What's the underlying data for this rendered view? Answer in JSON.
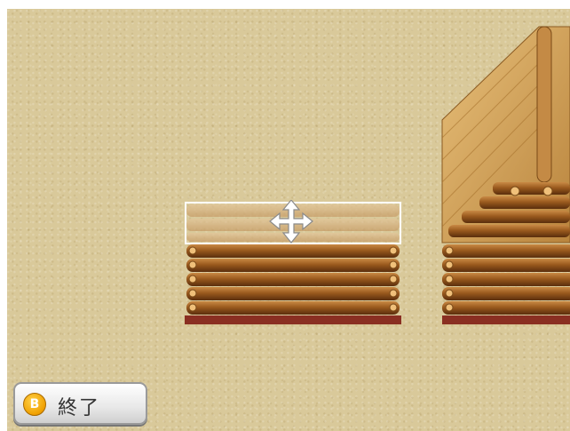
{
  "finish_button": {
    "badge": "B",
    "label": "終了"
  },
  "icons": {
    "move": "move-arrows-icon"
  },
  "colors": {
    "ground": "#d9c99a",
    "log": "#9a5a1e",
    "log_dark": "#5a2e0c",
    "roof": "#d7a95a",
    "foundation": "#8a2f22",
    "button_badge": "#f0a000"
  }
}
